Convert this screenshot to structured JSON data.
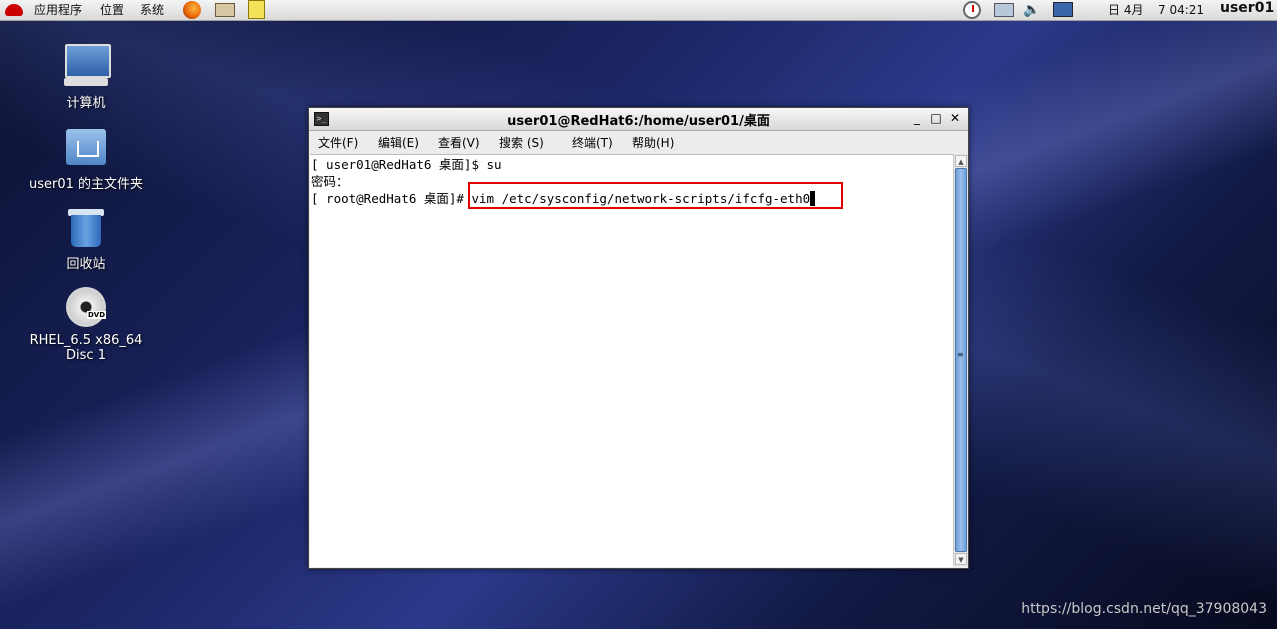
{
  "topbar": {
    "menus": [
      "应用程序",
      "位置",
      "系统"
    ],
    "date": "日 4月",
    "time": "7 04:21",
    "user": "user01"
  },
  "desktop": {
    "icons": [
      {
        "label": "计算机",
        "icon": "computer-icon"
      },
      {
        "label": "user01 的主文件夹",
        "icon": "home-folder-icon"
      },
      {
        "label": "回收站",
        "icon": "trash-icon"
      },
      {
        "label_line1": "RHEL_6.5 x86_64",
        "label_line2": "Disc 1",
        "icon": "dvd-icon"
      }
    ]
  },
  "window": {
    "title": "user01@RedHat6:/home/user01/桌面",
    "controls": {
      "minimize": "_",
      "maximize": "□",
      "close": "✕"
    },
    "menu": [
      "文件(F)",
      "编辑(E)",
      "查看(V)",
      "搜索 (S)",
      "终端(T)",
      "帮助(H)"
    ],
    "terminal": {
      "line1": "[ user01@RedHat6 桌面]$ su",
      "line2": "密码：",
      "line3_prompt": "[ root@RedHat6 桌面]# ",
      "line3_command": "vim /etc/sysconfig/network-scripts/ifcfg-eth0"
    },
    "highlight_color": "#e00000"
  },
  "watermark": "https://blog.csdn.net/qq_37908043"
}
